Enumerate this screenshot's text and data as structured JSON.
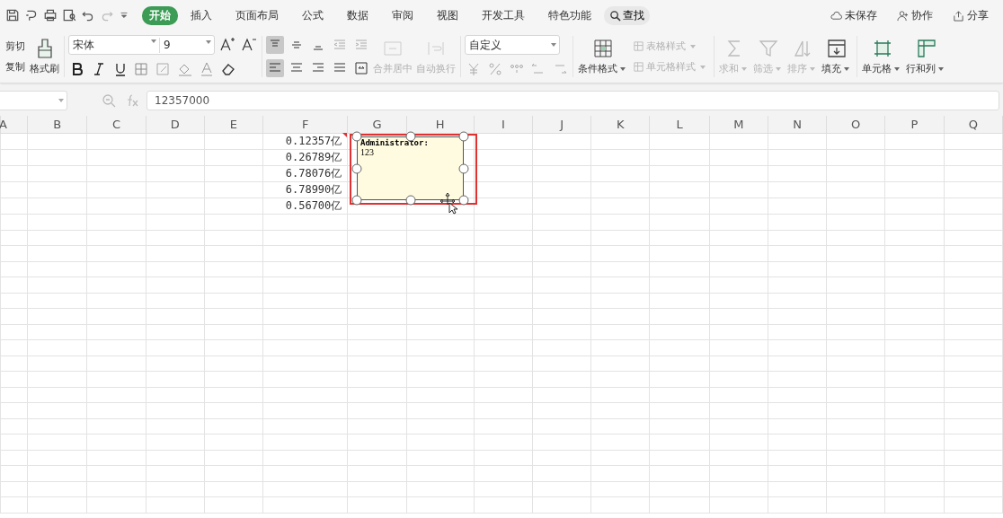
{
  "tabs": [
    {
      "label": "开始",
      "selected": true
    },
    {
      "label": "插入",
      "selected": false
    },
    {
      "label": "页面布局",
      "selected": false
    },
    {
      "label": "公式",
      "selected": false
    },
    {
      "label": "数据",
      "selected": false
    },
    {
      "label": "审阅",
      "selected": false
    },
    {
      "label": "视图",
      "selected": false
    },
    {
      "label": "开发工具",
      "selected": false
    },
    {
      "label": "特色功能",
      "selected": false
    }
  ],
  "search": {
    "label": "查找"
  },
  "top_actions": [
    {
      "label": "未保存"
    },
    {
      "label": "协作"
    },
    {
      "label": "分享"
    }
  ],
  "ribbon": {
    "clipboard": {
      "cut": "剪切",
      "copy": "复制",
      "format_painter": "格式刷"
    },
    "font": {
      "font_name": "宋体",
      "font_size": "9"
    },
    "alignment": {
      "top_align": {
        "selected": true
      },
      "left_align": {
        "selected": true
      },
      "merge_center": {
        "label": "合并居中",
        "disabled": true
      },
      "wrap_text": {
        "label": "自动换行",
        "disabled": true
      }
    },
    "number": {
      "format": "自定义"
    },
    "styles": [
      {
        "label": "条件格式",
        "disabled": false
      },
      {
        "label": "表格样式",
        "disabled": true
      },
      {
        "label": "单元格样式",
        "disabled": true
      }
    ],
    "editing": [
      {
        "label": "求和",
        "disabled": true
      },
      {
        "label": "筛选",
        "disabled": true
      },
      {
        "label": "排序",
        "disabled": true
      },
      {
        "label": "填充",
        "disabled": false
      }
    ],
    "cells": [
      {
        "label": "单元格"
      },
      {
        "label": "行和列"
      }
    ]
  },
  "formula_bar": {
    "value": "12357000"
  },
  "columns": [
    "A",
    "B",
    "C",
    "D",
    "E",
    "F",
    "G",
    "H",
    "I",
    "J",
    "K",
    "L",
    "M",
    "N",
    "O",
    "P",
    "Q"
  ],
  "rows": [
    {
      "column_f": "0.12357亿"
    },
    {
      "column_f": "0.26789亿"
    },
    {
      "column_f": "6.78076亿"
    },
    {
      "column_f": "6.78990亿"
    },
    {
      "column_f": "0.56700亿"
    }
  ],
  "comment": {
    "author": "Administrator:",
    "text": "123"
  }
}
